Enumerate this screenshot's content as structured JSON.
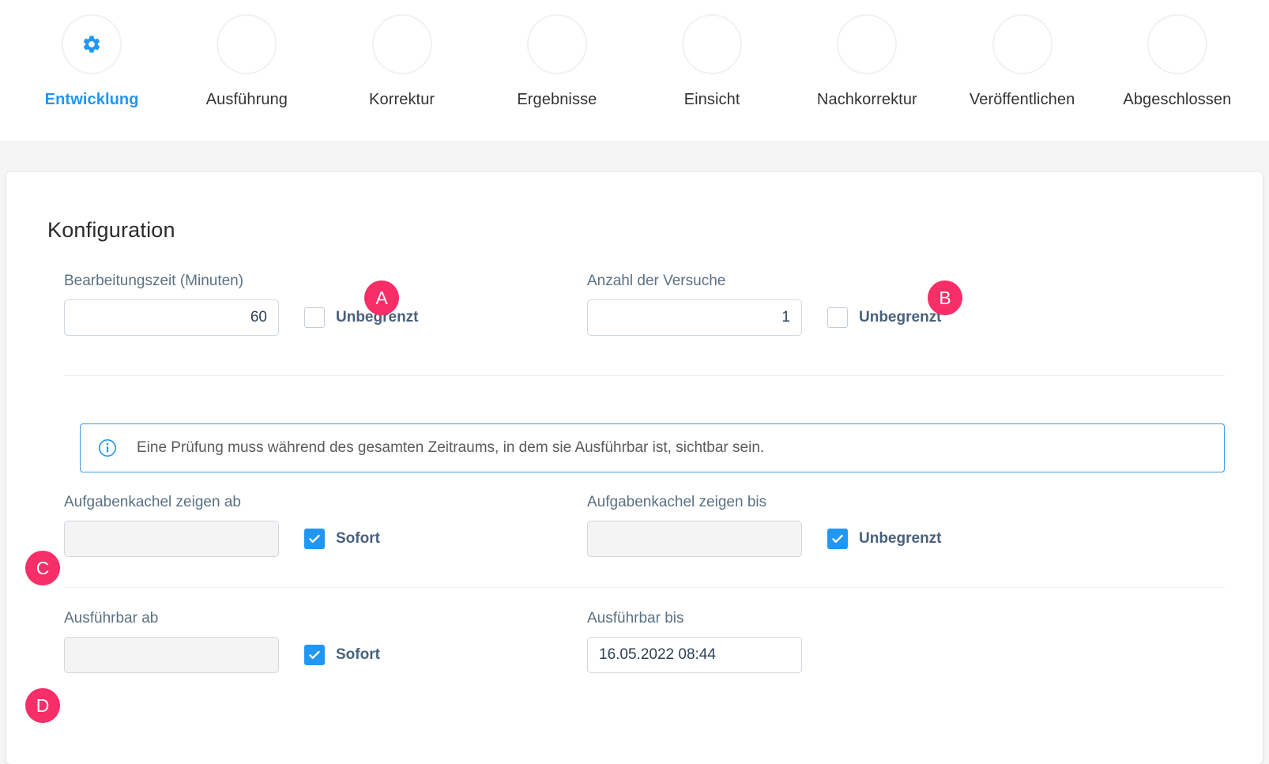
{
  "stepper": {
    "steps": [
      {
        "label": "Entwicklung",
        "icon": "gear-icon",
        "active": true
      },
      {
        "label": "Ausführung",
        "icon": "",
        "active": false
      },
      {
        "label": "Korrektur",
        "icon": "",
        "active": false
      },
      {
        "label": "Ergebnisse",
        "icon": "",
        "active": false
      },
      {
        "label": "Einsicht",
        "icon": "",
        "active": false
      },
      {
        "label": "Nachkorrektur",
        "icon": "",
        "active": false
      },
      {
        "label": "Veröffentlichen",
        "icon": "",
        "active": false
      },
      {
        "label": "Abgeschlossen",
        "icon": "",
        "active": false
      }
    ]
  },
  "card": {
    "title": "Konfiguration"
  },
  "fields": {
    "bearbeitungszeit": {
      "label": "Bearbeitungszeit (Minuten)",
      "value": "60",
      "checkbox_label": "Unbegrenzt",
      "checked": false
    },
    "versuche": {
      "label": "Anzahl der Versuche",
      "value": "1",
      "checkbox_label": "Unbegrenzt",
      "checked": false
    },
    "kachel_ab": {
      "label": "Aufgabenkachel zeigen ab",
      "value": "",
      "checkbox_label": "Sofort",
      "checked": true
    },
    "kachel_bis": {
      "label": "Aufgabenkachel zeigen bis",
      "value": "",
      "checkbox_label": "Unbegrenzt",
      "checked": true
    },
    "ausfuehrbar_ab": {
      "label": "Ausführbar ab",
      "value": "",
      "checkbox_label": "Sofort",
      "checked": true
    },
    "ausfuehrbar_bis": {
      "label": "Ausführbar bis",
      "value": "16.05.2022 08:44",
      "checkbox_label": "",
      "checked": false
    }
  },
  "banner": {
    "icon": "info-circle-icon",
    "text": "Eine Prüfung muss während des gesamten Zeitraums, in dem sie Ausführbar ist, sichtbar sein."
  },
  "annotations": [
    {
      "id": "A",
      "label": "A"
    },
    {
      "id": "B",
      "label": "B"
    },
    {
      "id": "C",
      "label": "C"
    },
    {
      "id": "D",
      "label": "D"
    }
  ],
  "colors": {
    "accent_blue": "#2196f3",
    "annotation_pink": "#f72e68",
    "label_slate": "#5a7184",
    "page_bg": "#f5f5f5"
  }
}
